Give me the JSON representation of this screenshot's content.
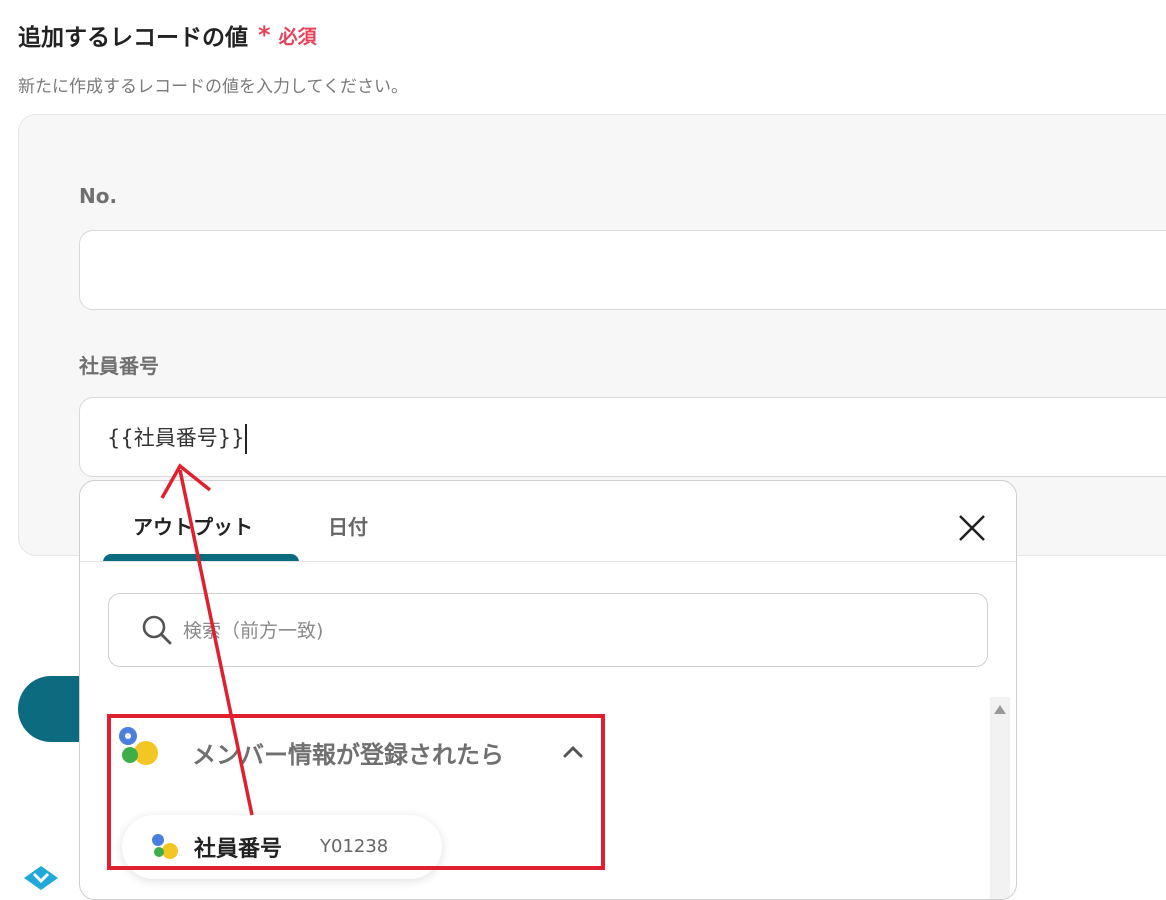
{
  "section": {
    "title": "追加するレコードの値",
    "required_mark": "*",
    "required_label": "必須",
    "description": "新たに作成するレコードの値を入力してください。"
  },
  "fields": [
    {
      "label": "No.",
      "value": ""
    },
    {
      "label": "社員番号",
      "value": "{{社員番号}}"
    }
  ],
  "dropdown": {
    "tabs": [
      {
        "label": "アウトプット",
        "active": true
      },
      {
        "label": "日付",
        "active": false
      }
    ],
    "search": {
      "placeholder": "検索（前方一致)",
      "value": ""
    },
    "group": {
      "title": "メンバー情報が登録されたら",
      "expanded": true,
      "items": [
        {
          "label": "社員番号",
          "value": "Y01238"
        }
      ]
    }
  },
  "colors": {
    "accent": "#0d6b80",
    "required": "#e8425a",
    "annotation": "#e0202e"
  }
}
